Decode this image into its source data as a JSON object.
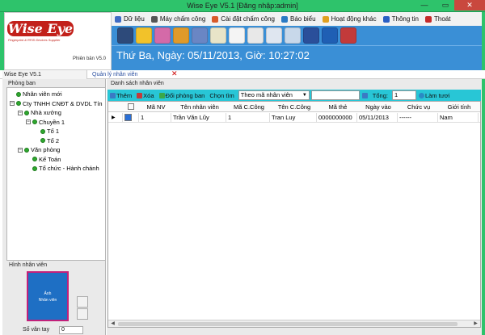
{
  "window": {
    "title": "Wise Eye V5.1 [Đăng nhập:admin]",
    "min": "—",
    "max": "▭",
    "close": "✕"
  },
  "logo": {
    "main": "Wise Eye",
    "sub": "Fingerprint & RFID Devices Supplier",
    "version": "Phiên bản V5.0"
  },
  "menu": [
    {
      "label": "Dữ liệu",
      "color": "#3f6cc4"
    },
    {
      "label": "Máy chấm công",
      "color": "#555555"
    },
    {
      "label": "Cài đặt chấm công",
      "color": "#d85a2a"
    },
    {
      "label": "Báo biểu",
      "color": "#2a7ac4"
    },
    {
      "label": "Hoạt động khác",
      "color": "#e0a020"
    },
    {
      "label": "Thông tin",
      "color": "#2a5fc4"
    },
    {
      "label": "Thoát",
      "color": "#c42a2a"
    }
  ],
  "toolbar_icons": [
    {
      "name": "computer-icon",
      "color": "#2d4a7a"
    },
    {
      "name": "upload-icon",
      "color": "#f2c22a"
    },
    {
      "name": "users-icon",
      "color": "#d46aa8"
    },
    {
      "name": "chart-icon",
      "color": "#e09a2a"
    },
    {
      "name": "group-icon",
      "color": "#6a86c4"
    },
    {
      "name": "notepad-icon",
      "color": "#e8e4c8"
    },
    {
      "name": "clock-icon",
      "color": "#f4f4f4"
    },
    {
      "name": "calendar-icon",
      "color": "#e8e8e8"
    },
    {
      "name": "document-icon",
      "color": "#dfe6f0"
    },
    {
      "name": "search-report-icon",
      "color": "#c8d8ea"
    },
    {
      "name": "user-settings-icon",
      "color": "#2a4f9a"
    },
    {
      "name": "info-icon",
      "color": "#1f5fb4"
    },
    {
      "name": "exit-icon",
      "color": "#c23a3a"
    }
  ],
  "banner": {
    "text": "Thứ Ba, Ngày: 05/11/2013, Giờ: 10:27:02"
  },
  "tabs": {
    "main": "Wise Eye V5.1",
    "active": "Quản lý nhân viên",
    "close": "✕"
  },
  "left": {
    "dept_label": "Phòng ban",
    "tree": [
      {
        "label": "Nhân viên mới",
        "level": 0,
        "expander": false
      },
      {
        "label": "Cty TNHH CNĐT & DVDL Tín",
        "level": 0,
        "expander": true
      },
      {
        "label": "Nhà xưởng",
        "level": 1,
        "expander": true
      },
      {
        "label": "Chuyền 1",
        "level": 2,
        "expander": true
      },
      {
        "label": "Tổ 1",
        "level": 3,
        "expander": false
      },
      {
        "label": "Tổ 2",
        "level": 3,
        "expander": false
      },
      {
        "label": "Văn phòng",
        "level": 1,
        "expander": true
      },
      {
        "label": "Kế Toán",
        "level": 2,
        "expander": false
      },
      {
        "label": "Tổ chức - Hành chánh",
        "level": 2,
        "expander": false
      }
    ],
    "photo_label": "Hình nhân viên",
    "photo_text_1": "Ảnh",
    "photo_text_2": "Nhân viên",
    "fingerprint_label": "Số vân tay",
    "fingerprint_value": "0"
  },
  "right": {
    "list_label": "Danh sách nhân viên",
    "toolbar": {
      "add": "Thêm",
      "delete": "Xóa",
      "change_dept": "Đổi phòng ban",
      "search": "Chọn tìm",
      "search_by": "Theo mã nhân viên",
      "total_label": "Tổng:",
      "total": "1",
      "refresh": "Làm tươi"
    },
    "columns": [
      "Mã NV",
      "Tên nhân viên",
      "Mã C.Công",
      "Tên C.Công",
      "Mã thẻ",
      "Ngày vào",
      "Chức vụ",
      "Giới tính"
    ],
    "rows": [
      [
        "1",
        "Trần Văn Lũy",
        "1",
        "Tran Luy",
        "0000000000",
        "05/11/2013",
        "------",
        "Nam"
      ]
    ]
  }
}
